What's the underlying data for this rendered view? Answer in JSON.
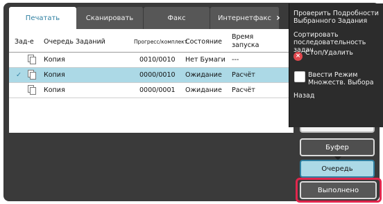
{
  "tabs": [
    {
      "label": "Печатать",
      "active": true
    },
    {
      "label": "Сканировать",
      "active": false
    },
    {
      "label": "Факс",
      "active": false
    },
    {
      "label": "Интернетфакс",
      "active": false
    }
  ],
  "table": {
    "headers": {
      "task": "Зад-е",
      "queue": "Очередь Заданий",
      "progress": "Прогресс/комплект",
      "state": "Состояние",
      "time": "Время запуска"
    },
    "rows": [
      {
        "selected": false,
        "check": "",
        "name": "Копия",
        "progress": "0010/0010",
        "state": "Нет Бумаги",
        "time": "---"
      },
      {
        "selected": true,
        "check": "✓",
        "name": "Копия",
        "progress": "0000/0010",
        "state": "Ожидание",
        "time": "Расчёт"
      },
      {
        "selected": false,
        "check": "",
        "name": "Копия",
        "progress": "0000/0001",
        "state": "Ожидание",
        "time": "Расчёт"
      }
    ]
  },
  "menu": {
    "details": "Проверить Подробности Выбранного Задания",
    "sort": "Сортировать последовательность задач",
    "stop": "Стоп/Удалить",
    "multi": "Ввести Режим Множеств. Выбора",
    "back": "Назад"
  },
  "side": {
    "buffer": "Буфер",
    "queue": "Очередь",
    "done": "Выполнено"
  },
  "colors": {
    "accent": "#2e7fa1",
    "selected_row": "#acd9e6",
    "highlight": "#e2264d",
    "stop_icon": "#e0484e"
  }
}
